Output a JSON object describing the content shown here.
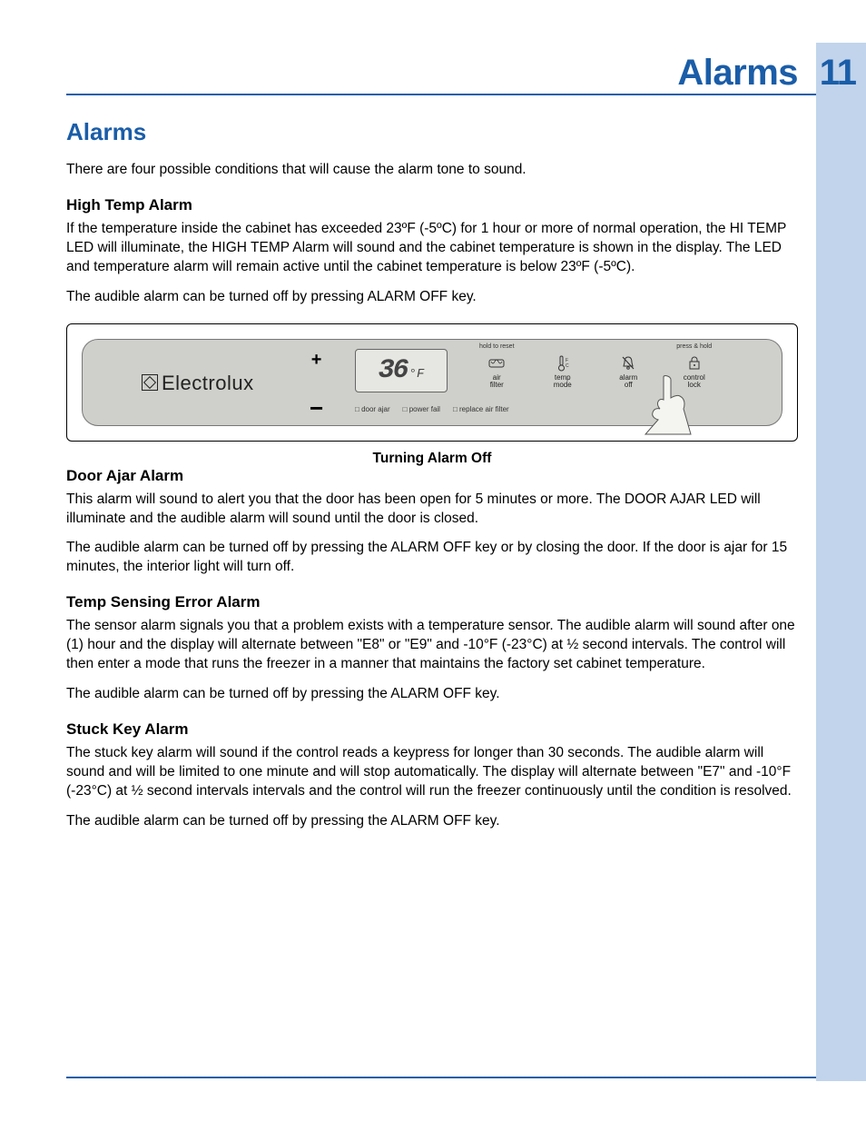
{
  "page_number": "11",
  "page_title": "Alarms",
  "section_title": "Alarms",
  "intro": "There are four possible conditions that will cause the alarm tone to sound.",
  "high_temp": {
    "heading": "High Temp Alarm",
    "p1": "If the temperature inside the cabinet has exceeded 23ºF (-5ºC) for 1 hour or more of normal operation, the HI TEMP LED will illuminate, the HIGH TEMP Alarm will sound and the cabinet temperature is shown in the display.   The LED and temperature alarm will remain active until the cabinet temperature is below 23ºF (-5ºC).",
    "p2": "The audible alarm can be turned off by pressing ALARM OFF key."
  },
  "figure": {
    "brand": "Electrolux",
    "temp_value": "36",
    "temp_unit": "°F",
    "indicators": {
      "door_ajar": "door ajar",
      "power_fail": "power fail",
      "replace_filter": "replace air filter"
    },
    "buttons": {
      "air_filter": {
        "hint": "hold to reset",
        "label": "air\nfilter"
      },
      "temp_mode": {
        "hint": "",
        "label": "temp\nmode"
      },
      "alarm_off": {
        "hint": "",
        "label": "alarm\noff"
      },
      "control_lock": {
        "hint": "press & hold",
        "label": "control\nlock"
      }
    },
    "caption": "Turning Alarm Off"
  },
  "door_ajar": {
    "heading": "Door Ajar Alarm",
    "p1": "This alarm will sound to alert you that the door has been open for 5 minutes or more.  The DOOR AJAR LED will illuminate and the audible alarm will sound until the door is closed.",
    "p2": "The audible alarm can be turned off by pressing the ALARM OFF key or by closing the door.  If the door is ajar for 15 minutes, the interior light will turn off."
  },
  "temp_sensing": {
    "heading": "Temp Sensing Error Alarm",
    "p1": "The sensor alarm signals you that a problem exists with a temperature sensor.  The audible alarm will sound after one (1) hour and the display will alternate between \"E8\" or \"E9\" and -10°F (-23°C) at ½ second intervals.  The control will then enter a mode that runs the freezer in a manner that maintains the factory set cabinet temperature.",
    "p2": "The audible alarm can be turned off by pressing the ALARM OFF key."
  },
  "stuck_key": {
    "heading": "Stuck Key Alarm",
    "p1": "The stuck key alarm will sound if the control reads a keypress for longer than 30 seconds.  The audible alarm will sound and will be limited to one minute and will stop automatically.  The display will alternate between \"E7\" and -10°F (-23°C) at ½ second intervals intervals and the control will run the freezer continuously until the condition is resolved.",
    "p2": "The audible alarm can be turned off by pressing the ALARM OFF key."
  }
}
